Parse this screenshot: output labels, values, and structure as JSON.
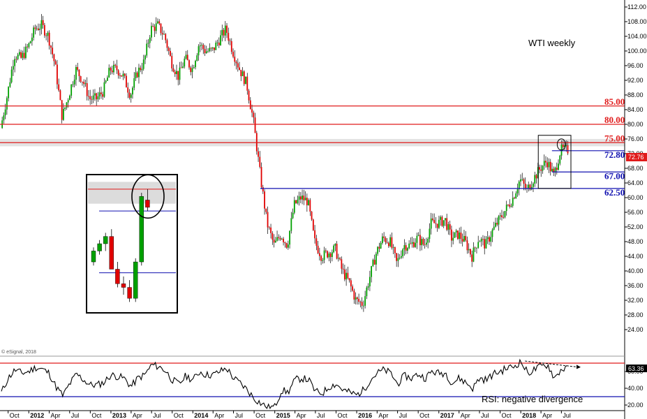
{
  "chart_data": {
    "type": "candlestick",
    "title": "WTI weekly",
    "price_axis": {
      "ylim": [
        20,
        112
      ],
      "ticks": [
        "112.00",
        "108.00",
        "104.00",
        "100.00",
        "96.00",
        "92.00",
        "88.00",
        "84.00",
        "80.00",
        "76.00",
        "72.00",
        "68.00",
        "64.00",
        "60.00",
        "56.00",
        "52.00",
        "48.00",
        "44.00",
        "40.00",
        "36.00",
        "32.00",
        "28.00",
        "24.00"
      ],
      "current_price": "72.76"
    },
    "x_ticks": [
      "Oct",
      "2012",
      "Apr",
      "Jul",
      "Oct",
      "2013",
      "Apr",
      "Jul",
      "Oct",
      "2014",
      "Apr",
      "Jul",
      "Oct",
      "2015",
      "Apr",
      "Jul",
      "Oct",
      "2016",
      "Apr",
      "Jul",
      "Oct",
      "2017",
      "Apr",
      "Jul",
      "Oct",
      "2018",
      "Apr",
      "Jul"
    ],
    "resistance_levels": [
      {
        "label": "85.00",
        "value": 85.0
      },
      {
        "label": "80.00",
        "value": 80.0
      },
      {
        "label": "75.00",
        "value": 75.0
      }
    ],
    "support_levels": [
      {
        "label": "72.80",
        "value": 72.8
      },
      {
        "label": "67.00",
        "value": 67.0
      },
      {
        "label": "62.50",
        "value": 62.5
      }
    ],
    "weekly_anchors": [
      [
        "2011-09",
        79
      ],
      [
        "2011-10",
        88
      ],
      [
        "2011-11",
        99
      ],
      [
        "2011-12",
        98
      ],
      [
        "2012-01",
        101
      ],
      [
        "2012-02",
        106
      ],
      [
        "2012-03",
        107
      ],
      [
        "2012-04",
        104
      ],
      [
        "2012-05",
        96
      ],
      [
        "2012-06",
        82
      ],
      [
        "2012-07",
        88
      ],
      [
        "2012-08",
        95
      ],
      [
        "2012-09",
        92
      ],
      [
        "2012-10",
        87
      ],
      [
        "2012-11",
        87
      ],
      [
        "2012-12",
        89
      ],
      [
        "2013-01",
        95
      ],
      [
        "2013-02",
        95
      ],
      [
        "2013-03",
        93
      ],
      [
        "2013-04",
        88
      ],
      [
        "2013-05",
        94
      ],
      [
        "2013-06",
        97
      ],
      [
        "2013-07",
        106
      ],
      [
        "2013-08",
        107
      ],
      [
        "2013-09",
        104
      ],
      [
        "2013-10",
        97
      ],
      [
        "2013-11",
        93
      ],
      [
        "2013-12",
        98
      ],
      [
        "2014-01",
        95
      ],
      [
        "2014-02",
        102
      ],
      [
        "2014-03",
        100
      ],
      [
        "2014-04",
        100
      ],
      [
        "2014-05",
        103
      ],
      [
        "2014-06",
        106
      ],
      [
        "2014-07",
        100
      ],
      [
        "2014-08",
        95
      ],
      [
        "2014-09",
        91
      ],
      [
        "2014-10",
        81
      ],
      [
        "2014-11",
        66
      ],
      [
        "2014-12",
        53
      ],
      [
        "2015-01",
        47
      ],
      [
        "2015-02",
        50
      ],
      [
        "2015-03",
        47
      ],
      [
        "2015-04",
        58
      ],
      [
        "2015-05",
        60
      ],
      [
        "2015-06",
        59
      ],
      [
        "2015-07",
        48
      ],
      [
        "2015-08",
        44
      ],
      [
        "2015-09",
        45
      ],
      [
        "2015-10",
        46
      ],
      [
        "2015-11",
        40
      ],
      [
        "2015-12",
        37
      ],
      [
        "2016-01",
        32
      ],
      [
        "2016-02",
        31
      ],
      [
        "2016-03",
        38
      ],
      [
        "2016-04",
        45
      ],
      [
        "2016-05",
        49
      ],
      [
        "2016-06",
        48
      ],
      [
        "2016-07",
        42
      ],
      [
        "2016-08",
        47
      ],
      [
        "2016-09",
        47
      ],
      [
        "2016-10",
        49
      ],
      [
        "2016-11",
        47
      ],
      [
        "2016-12",
        53
      ],
      [
        "2017-01",
        53
      ],
      [
        "2017-02",
        54
      ],
      [
        "2017-03",
        49
      ],
      [
        "2017-04",
        50
      ],
      [
        "2017-05",
        48
      ],
      [
        "2017-06",
        44
      ],
      [
        "2017-07",
        49
      ],
      [
        "2017-08",
        47
      ],
      [
        "2017-09",
        51
      ],
      [
        "2017-10",
        54
      ],
      [
        "2017-11",
        57
      ],
      [
        "2017-12",
        60
      ],
      [
        "2018-01",
        65
      ],
      [
        "2018-02",
        62
      ],
      [
        "2018-03",
        65
      ],
      [
        "2018-04",
        68
      ],
      [
        "2018-05",
        70
      ],
      [
        "2018-06",
        66
      ],
      [
        "2018-07",
        73
      ]
    ],
    "inset_candles": [
      {
        "o": 44,
        "h": 48,
        "l": 43,
        "c": 47,
        "color": "green"
      },
      {
        "o": 47,
        "h": 50,
        "l": 46,
        "c": 49,
        "color": "green"
      },
      {
        "o": 49,
        "h": 52,
        "l": 47,
        "c": 51,
        "color": "green"
      },
      {
        "o": 51,
        "h": 53,
        "l": 43,
        "c": 42,
        "color": "red"
      },
      {
        "o": 42,
        "h": 44,
        "l": 37,
        "c": 38,
        "color": "red"
      },
      {
        "o": 38,
        "h": 40,
        "l": 35,
        "c": 37,
        "color": "red"
      },
      {
        "o": 37,
        "h": 39,
        "l": 33,
        "c": 34,
        "color": "red"
      },
      {
        "o": 34,
        "h": 45,
        "l": 33,
        "c": 44,
        "color": "green"
      },
      {
        "o": 44,
        "h": 63,
        "l": 43,
        "c": 62,
        "color": "green"
      },
      {
        "o": 61,
        "h": 64,
        "l": 58,
        "c": 59,
        "color": "red"
      }
    ],
    "rsi": {
      "label": "RSI: negative divergence",
      "ylim": [
        15,
        75
      ],
      "ticks": [
        "60.00",
        "40.00",
        "20.00"
      ],
      "upper": 70,
      "lower": 30,
      "current": "63.36",
      "anchors": [
        [
          "2011-09",
          35
        ],
        [
          "2011-10",
          52
        ],
        [
          "2011-11",
          62
        ],
        [
          "2011-12",
          58
        ],
        [
          "2012-01",
          60
        ],
        [
          "2012-02",
          65
        ],
        [
          "2012-03",
          63
        ],
        [
          "2012-04",
          58
        ],
        [
          "2012-05",
          42
        ],
        [
          "2012-06",
          31
        ],
        [
          "2012-07",
          45
        ],
        [
          "2012-08",
          57
        ],
        [
          "2012-09",
          50
        ],
        [
          "2012-10",
          44
        ],
        [
          "2012-11",
          44
        ],
        [
          "2012-12",
          47
        ],
        [
          "2013-01",
          56
        ],
        [
          "2013-02",
          54
        ],
        [
          "2013-03",
          52
        ],
        [
          "2013-04",
          42
        ],
        [
          "2013-05",
          52
        ],
        [
          "2013-06",
          56
        ],
        [
          "2013-07",
          68
        ],
        [
          "2013-08",
          66
        ],
        [
          "2013-09",
          61
        ],
        [
          "2013-10",
          50
        ],
        [
          "2013-11",
          45
        ],
        [
          "2013-12",
          55
        ],
        [
          "2014-01",
          50
        ],
        [
          "2014-02",
          60
        ],
        [
          "2014-03",
          56
        ],
        [
          "2014-04",
          56
        ],
        [
          "2014-05",
          60
        ],
        [
          "2014-06",
          64
        ],
        [
          "2014-07",
          52
        ],
        [
          "2014-08",
          46
        ],
        [
          "2014-09",
          38
        ],
        [
          "2014-10",
          28
        ],
        [
          "2014-11",
          22
        ],
        [
          "2014-12",
          17
        ],
        [
          "2015-01",
          18
        ],
        [
          "2015-02",
          38
        ],
        [
          "2015-03",
          35
        ],
        [
          "2015-04",
          50
        ],
        [
          "2015-05",
          52
        ],
        [
          "2015-06",
          50
        ],
        [
          "2015-07",
          36
        ],
        [
          "2015-08",
          34
        ],
        [
          "2015-09",
          42
        ],
        [
          "2015-10",
          45
        ],
        [
          "2015-11",
          38
        ],
        [
          "2015-12",
          35
        ],
        [
          "2016-01",
          32
        ],
        [
          "2016-02",
          38
        ],
        [
          "2016-03",
          50
        ],
        [
          "2016-04",
          58
        ],
        [
          "2016-05",
          62
        ],
        [
          "2016-06",
          58
        ],
        [
          "2016-07",
          45
        ],
        [
          "2016-08",
          55
        ],
        [
          "2016-09",
          52
        ],
        [
          "2016-10",
          57
        ],
        [
          "2016-11",
          52
        ],
        [
          "2016-12",
          60
        ],
        [
          "2017-01",
          58
        ],
        [
          "2017-02",
          58
        ],
        [
          "2017-03",
          46
        ],
        [
          "2017-04",
          52
        ],
        [
          "2017-05",
          47
        ],
        [
          "2017-06",
          40
        ],
        [
          "2017-07",
          52
        ],
        [
          "2017-08",
          50
        ],
        [
          "2017-09",
          57
        ],
        [
          "2017-10",
          60
        ],
        [
          "2017-11",
          64
        ],
        [
          "2017-12",
          66
        ],
        [
          "2018-01",
          72
        ],
        [
          "2018-02",
          58
        ],
        [
          "2018-03",
          62
        ],
        [
          "2018-04",
          66
        ],
        [
          "2018-05",
          68
        ],
        [
          "2018-06",
          52
        ],
        [
          "2018-07",
          63
        ]
      ]
    }
  },
  "credit": "© eSignal, 2018"
}
